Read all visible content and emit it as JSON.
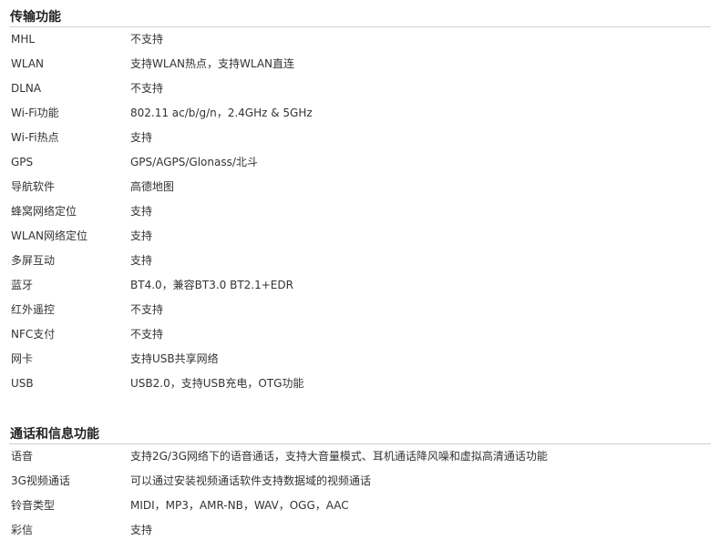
{
  "sections": [
    {
      "title": "传输功能",
      "rows": [
        {
          "label": "MHL",
          "value": "不支持"
        },
        {
          "label": "WLAN",
          "value": "支持WLAN热点，支持WLAN直连"
        },
        {
          "label": "DLNA",
          "value": "不支持"
        },
        {
          "label": "Wi-Fi功能",
          "value": "802.11 ac/b/g/n，2.4GHz & 5GHz"
        },
        {
          "label": "Wi-Fi热点",
          "value": "支持"
        },
        {
          "label": "GPS",
          "value": "GPS/AGPS/Glonass/北斗"
        },
        {
          "label": "导航软件",
          "value": "高德地图"
        },
        {
          "label": "蜂窝网络定位",
          "value": "支持"
        },
        {
          "label": "WLAN网络定位",
          "value": "支持"
        },
        {
          "label": "多屏互动",
          "value": "支持"
        },
        {
          "label": "蓝牙",
          "value": "BT4.0，兼容BT3.0 BT2.1+EDR"
        },
        {
          "label": "红外遥控",
          "value": "不支持"
        },
        {
          "label": "NFC支付",
          "value": "不支持"
        },
        {
          "label": "网卡",
          "value": "支持USB共享网络"
        },
        {
          "label": "USB",
          "value": "USB2.0，支持USB充电，OTG功能"
        }
      ]
    },
    {
      "title": "通话和信息功能",
      "rows": [
        {
          "label": "语音",
          "value": "支持2G/3G网络下的语音通话，支持大音量模式、耳机通话降风噪和虚拟高清通话功能"
        },
        {
          "label": "3G视频通话",
          "value": "可以通过安装视频通话软件支持数据域的视频通话"
        },
        {
          "label": "铃音类型",
          "value": "MIDI，MP3，AMR-NB，WAV，OGG，AAC"
        },
        {
          "label": "彩信",
          "value": "支持"
        }
      ]
    }
  ]
}
